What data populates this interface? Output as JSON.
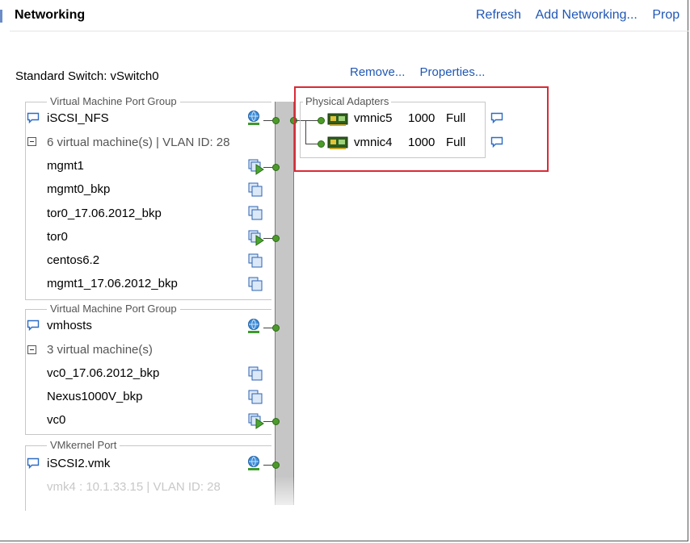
{
  "header": {
    "title": "Networking",
    "links": [
      "Refresh",
      "Add Networking...",
      "Prop"
    ]
  },
  "switch": {
    "title": "Standard Switch: vSwitch0",
    "links": [
      "Remove...",
      "Properties..."
    ]
  },
  "groups": [
    {
      "label": "Virtual Machine Port Group",
      "name": "iSCSI_NFS",
      "summary": "6 virtual machine(s) | VLAN ID: 28",
      "vms": [
        {
          "name": "mgmt1",
          "state": "powered-on"
        },
        {
          "name": "mgmt0_bkp",
          "state": "powered-off"
        },
        {
          "name": "tor0_17.06.2012_bkp",
          "state": "powered-off"
        },
        {
          "name": "tor0",
          "state": "powered-on"
        },
        {
          "name": "centos6.2",
          "state": "powered-off"
        },
        {
          "name": "mgmt1_17.06.2012_bkp",
          "state": "powered-off"
        }
      ]
    },
    {
      "label": "Virtual Machine Port Group",
      "name": "vmhosts",
      "summary": "3 virtual machine(s)",
      "vms": [
        {
          "name": "vc0_17.06.2012_bkp",
          "state": "powered-off"
        },
        {
          "name": "Nexus1000V_bkp",
          "state": "powered-off"
        },
        {
          "name": "vc0",
          "state": "powered-on"
        }
      ]
    },
    {
      "label": "VMkernel Port",
      "name": "iSCSI2.vmk",
      "summary": "vmk4 : 10.1.33.15 | VLAN ID: 28"
    }
  ],
  "physical_adapters": {
    "label": "Physical Adapters",
    "adapters": [
      {
        "name": "vmnic5",
        "speed": "1000",
        "duplex": "Full"
      },
      {
        "name": "vmnic4",
        "speed": "1000",
        "duplex": "Full"
      }
    ]
  },
  "colors": {
    "link": "#1f57b6",
    "highlight_box": "#d92b36",
    "connector_green": "#4d9a2b",
    "switch_spine": "#c6c6c6"
  },
  "icons": {
    "port_group": "network-globe-icon",
    "vm_on": "vm-powered-on-icon",
    "vm_off": "vm-icon",
    "nic": "network-card-icon",
    "info": "speech-bubble-icon"
  }
}
